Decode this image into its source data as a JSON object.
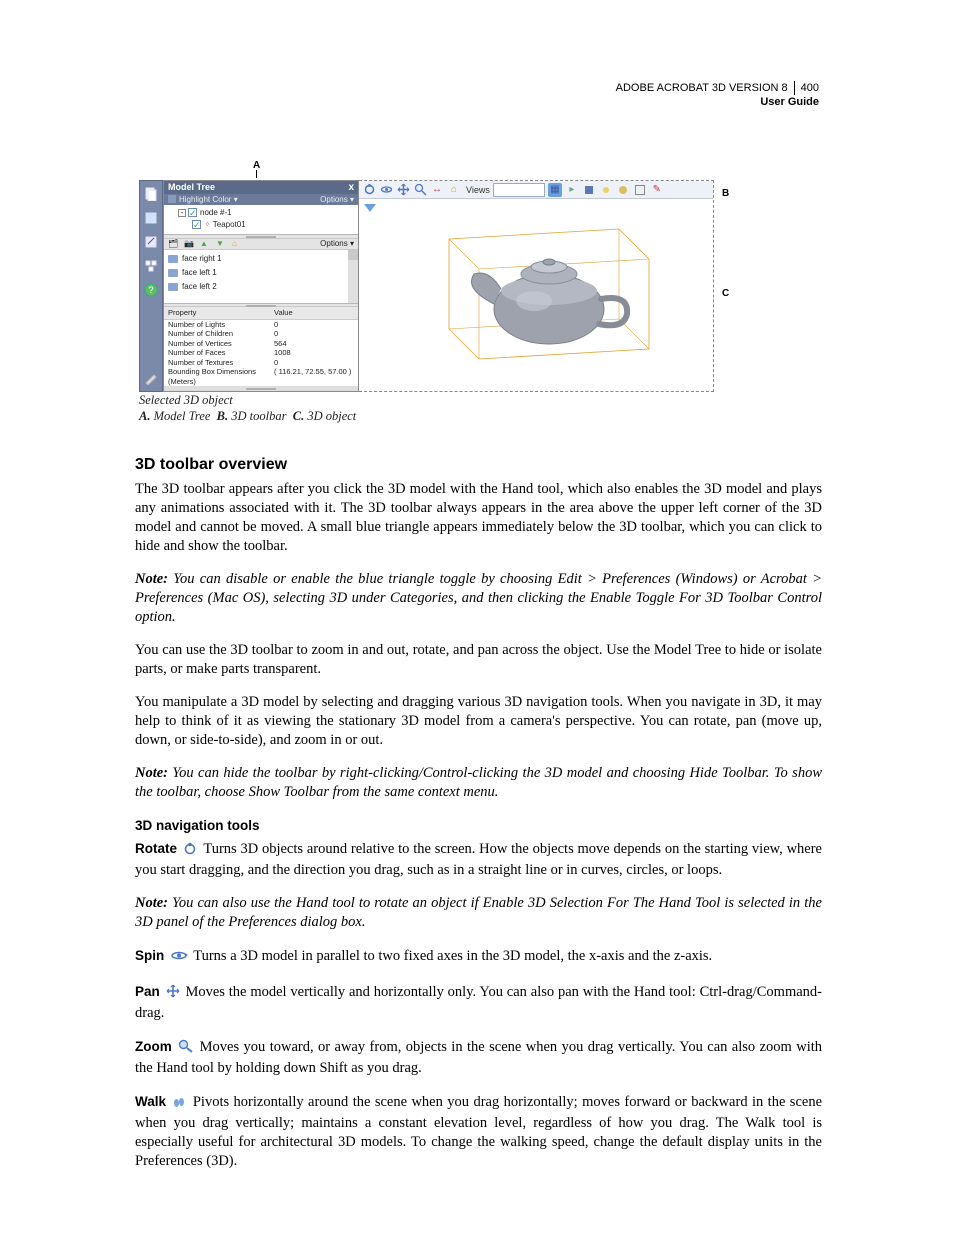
{
  "header": {
    "product": "ADOBE ACROBAT 3D VERSION 8",
    "page_number": "400",
    "doc_title": "User Guide"
  },
  "figure": {
    "labels": {
      "a": "A",
      "b": "B",
      "c": "C"
    },
    "sidebar_icons": [
      "pages-icon",
      "bookmarks-icon",
      "signatures-icon",
      "model-tree-icon",
      "help-icon",
      "pencil-icon"
    ],
    "model_tree": {
      "title": "Model Tree",
      "close_x": "x",
      "highlight_label": "Highlight Color",
      "options_label": "Options",
      "root_node": "node #-1",
      "child_node": "Teapot01"
    },
    "view_toolbar": {
      "options_label": "Options",
      "icons": [
        "views-icon",
        "camera-icon",
        "nav-up-icon",
        "nav-down-icon",
        "home-icon"
      ],
      "faces": [
        "face right 1",
        "face left 1",
        "face left 2"
      ]
    },
    "properties": {
      "header_prop": "Property",
      "header_val": "Value",
      "rows": [
        {
          "k": "Number of Lights",
          "v": "0"
        },
        {
          "k": "Number of Children",
          "v": "0"
        },
        {
          "k": "Number of Vertices",
          "v": "564"
        },
        {
          "k": "Number of Faces",
          "v": "1008"
        },
        {
          "k": "Number of Textures",
          "v": "0"
        },
        {
          "k": "Bounding Box Dimensions (Meters)",
          "v": "( 116.21, 72.55, 57.00 )"
        }
      ]
    },
    "viewer_toolbar": {
      "views_label": "Views"
    },
    "caption_line1": "Selected 3D object",
    "caption_legend": {
      "a": "Model Tree",
      "b": "3D toolbar",
      "c": "3D object"
    }
  },
  "body": {
    "h2": "3D toolbar overview",
    "p1": "The 3D toolbar appears after you click the 3D model with the Hand tool, which also enables the 3D model and plays any animations associated with it. The 3D toolbar always appears in the area above the upper left corner of the 3D model and cannot be moved. A small blue triangle appears immediately below the 3D toolbar, which you can click to hide and show the toolbar.",
    "note1_lead": "Note:",
    "note1": " You can disable or enable the blue triangle toggle by choosing Edit > Preferences (Windows) or Acrobat > Preferences (Mac OS), selecting 3D under Categories, and then clicking the Enable Toggle For 3D Toolbar Control option.",
    "p2": "You can use the 3D toolbar to zoom in and out, rotate, and pan across the object. Use the Model Tree to hide or isolate parts, or make parts transparent.",
    "p3": "You manipulate a 3D model by selecting and dragging various 3D navigation tools. When you navigate in 3D, it may help to think of it as viewing the stationary 3D model from a camera's perspective. You can rotate, pan (move up, down, or side-to-side), and zoom in or out.",
    "note2_lead": "Note:",
    "note2": " You can hide the toolbar by right-clicking/Control-clicking the 3D model and choosing Hide Toolbar. To show the toolbar, choose Show Toolbar from the same context menu.",
    "h3": "3D navigation tools",
    "tools": {
      "rotate_name": "Rotate",
      "rotate_text": "Turns 3D objects around relative to the screen. How the objects move depends on the starting view, where you start dragging, and the direction you drag, such as in a straight line or in curves, circles, or loops.",
      "rotate_note_lead": "Note:",
      "rotate_note": " You can also use the Hand tool to rotate an object if Enable 3D Selection For The Hand Tool is selected in the 3D panel of the Preferences dialog box.",
      "spin_name": "Spin",
      "spin_text": "Turns a 3D model in parallel to two fixed axes in the 3D model, the x-axis and the z-axis.",
      "pan_name": "Pan",
      "pan_text": "Moves the model vertically and horizontally only. You can also pan with the Hand tool: Ctrl-drag/Command-drag.",
      "zoom_name": "Zoom",
      "zoom_text": "Moves you toward, or away from, objects in the scene when you drag vertically. You can also zoom with the Hand tool by holding down Shift as you drag.",
      "walk_name": "Walk",
      "walk_text": "Pivots horizontally around the scene when you drag horizontally; moves forward or backward in the scene when you drag vertically; maintains a constant elevation level, regardless of how you drag. The Walk tool is especially useful for architectural 3D models. To change the walking speed, change the default display units in the Preferences (3D)."
    }
  }
}
